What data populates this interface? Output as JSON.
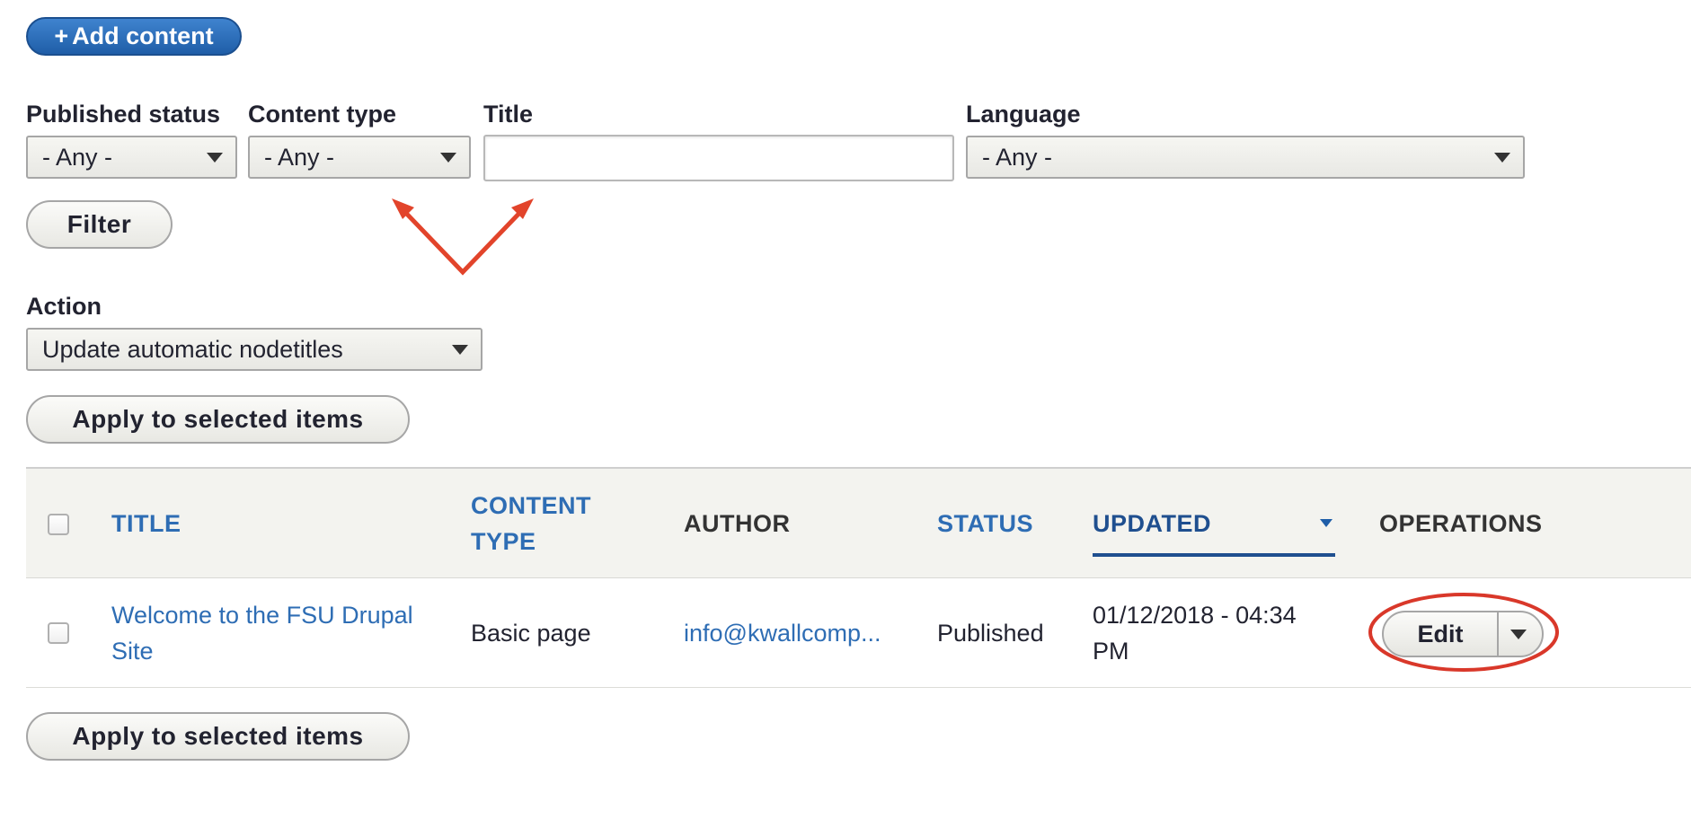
{
  "toolbar": {
    "add_content_label": "Add content",
    "add_icon": "+"
  },
  "filters": {
    "published_status": {
      "label": "Published status",
      "value": "- Any -"
    },
    "content_type": {
      "label": "Content type",
      "value": "- Any -"
    },
    "title": {
      "label": "Title",
      "value": "",
      "placeholder": ""
    },
    "language": {
      "label": "Language",
      "value": "- Any -"
    },
    "filter_button": "Filter"
  },
  "bulk": {
    "action_label": "Action",
    "action_value": "Update automatic nodetitles",
    "apply_label": "Apply to selected items"
  },
  "table": {
    "headers": {
      "title": "TITLE",
      "content_type_line1": "CONTENT",
      "content_type_line2": "TYPE",
      "author": "AUTHOR",
      "status": "STATUS",
      "updated": "UPDATED",
      "operations": "OPERATIONS"
    },
    "rows": [
      {
        "title_line1": "Welcome to the FSU Drupal",
        "title_line2": "Site",
        "content_type": "Basic page",
        "author": "info@kwallcomp...",
        "status": "Published",
        "updated_line1": "01/12/2018 - 04:34",
        "updated_line2": "PM",
        "operation": "Edit"
      }
    ]
  },
  "annotations": {
    "arrow_color": "#e2442b",
    "circle_color": "#d9382a"
  },
  "colors": {
    "primary": "#2f6fb8",
    "link": "#2e6db4"
  }
}
